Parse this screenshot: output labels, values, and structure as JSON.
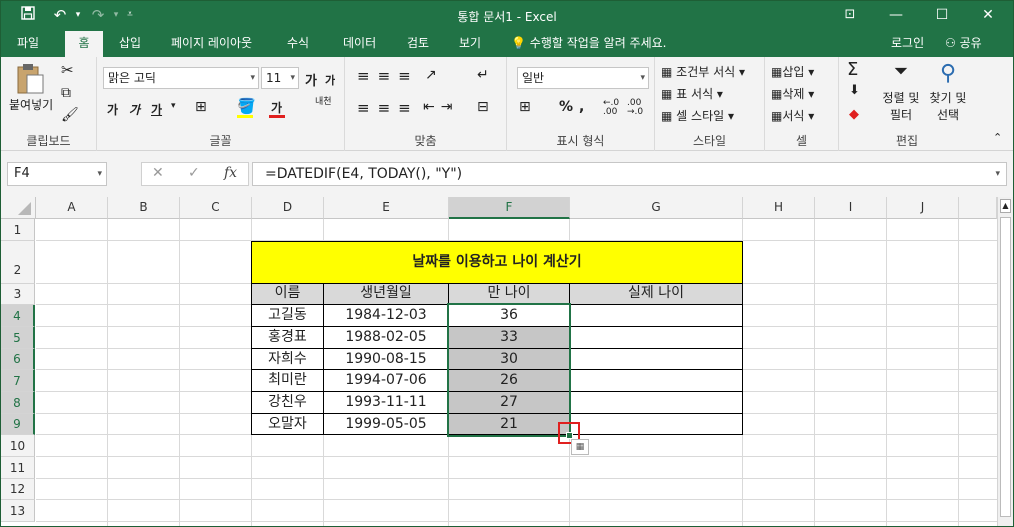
{
  "window": {
    "title": "통합 문서1 - Excel",
    "minimize": "—",
    "restore": "☐",
    "close": "✕",
    "ribbon_display": "⊡"
  },
  "quick_access": {
    "save_icon": "save-icon",
    "undo_icon": "undo-icon",
    "redo_icon": "redo-icon",
    "customize_icon": "customize-icon"
  },
  "tabs": [
    "파일",
    "홈",
    "삽입",
    "페이지 레이아웃",
    "수식",
    "데이터",
    "검토",
    "보기"
  ],
  "active_tab": "홈",
  "tell_me": "수행할 작업을 알려 주세요.",
  "login": "로그인",
  "share": "공유",
  "ribbon": {
    "clipboard": {
      "label": "클립보드",
      "paste": "붙여넣기"
    },
    "font": {
      "label": "글꼴",
      "font_name": "맑은 고딕",
      "font_size": "11",
      "grow": "가",
      "shrink": "가",
      "bold": "가",
      "italic": "가",
      "underline": "가",
      "font_color": "가",
      "phonetic": "내천"
    },
    "alignment": {
      "label": "맞춤"
    },
    "number": {
      "label": "표시 형식",
      "format": "일반"
    },
    "styles": {
      "label": "스타일",
      "conditional": "조건부 서식",
      "table_format": "표 서식",
      "cell_styles": "셀 스타일"
    },
    "cells": {
      "label": "셀",
      "insert": "삽입",
      "delete": "삭제",
      "format": "서식"
    },
    "editing": {
      "label": "편집",
      "sort_filter_1": "정렬 및",
      "sort_filter_2": "필터",
      "find_select_1": "찾기 및",
      "find_select_2": "선택"
    }
  },
  "formula_bar": {
    "name_box": "F4",
    "cancel": "✕",
    "enter": "✓",
    "fx": "fx",
    "formula": "=DATEDIF(E4, TODAY(), \"Y\")"
  },
  "columns": [
    "A",
    "B",
    "C",
    "D",
    "E",
    "F",
    "G",
    "H",
    "I",
    "J"
  ],
  "rows": [
    "1",
    "2",
    "3",
    "4",
    "5",
    "6",
    "7",
    "8",
    "9",
    "10",
    "11",
    "12",
    "13"
  ],
  "sheet": {
    "title": "날짜를 이용하고 나이 계산기",
    "headers": [
      "이름",
      "생년월일",
      "만 나이",
      "실제 나이"
    ],
    "records": [
      {
        "name": "고길동",
        "birth": "1984-12-03",
        "age": "36",
        "real_age": ""
      },
      {
        "name": "홍경표",
        "birth": "1988-02-05",
        "age": "33",
        "real_age": ""
      },
      {
        "name": "자희수",
        "birth": "1990-08-15",
        "age": "30",
        "real_age": ""
      },
      {
        "name": "최미란",
        "birth": "1994-07-06",
        "age": "26",
        "real_age": ""
      },
      {
        "name": "강친우",
        "birth": "1993-11-11",
        "age": "27",
        "real_age": ""
      },
      {
        "name": "오말자",
        "birth": "1999-05-05",
        "age": "21",
        "real_age": ""
      }
    ]
  },
  "colors": {
    "accent": "#217346",
    "title_fill": "#ffff00",
    "header_fill": "#d9d9d9",
    "selection_fill": "#c6c6c6",
    "highlight_box": "#e0201f"
  }
}
